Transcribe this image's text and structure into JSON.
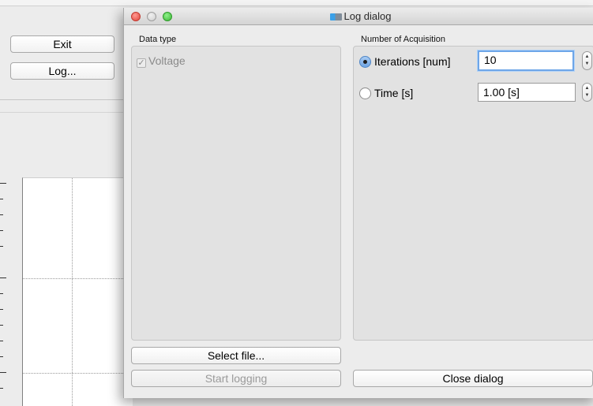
{
  "main_window": {
    "exit_label": "Exit",
    "log_label": "Log..."
  },
  "dialog": {
    "title": "Log dialog",
    "data_type": {
      "label": "Data type",
      "checkbox_label": "Voltage",
      "checkbox_checked": true,
      "checkbox_enabled": false
    },
    "acquisition": {
      "label": "Number of Acquisition",
      "iterations_label": "Iterations [num]",
      "iterations_selected": true,
      "iterations_value": "10",
      "time_label": "Time [s]",
      "time_selected": false,
      "time_value": "1.00 [s]"
    },
    "buttons": {
      "select_file": "Select file...",
      "start_logging": "Start logging",
      "close_dialog": "Close dialog"
    }
  }
}
